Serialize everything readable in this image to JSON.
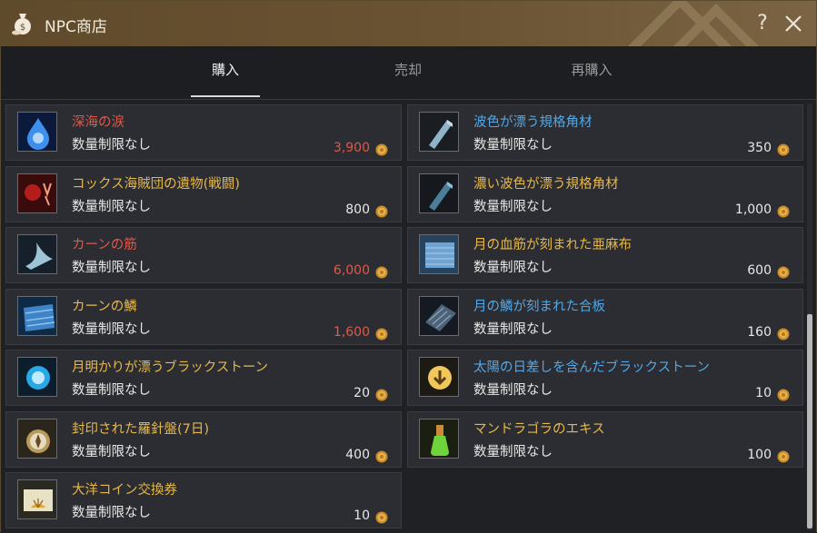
{
  "window": {
    "title": "NPC商店",
    "help_label": "?"
  },
  "tabs": [
    {
      "label": "購入",
      "active": true
    },
    {
      "label": "売却",
      "active": false
    },
    {
      "label": "再購入",
      "active": false
    }
  ],
  "colors": {
    "red_name": "#e0584a",
    "gold_name": "#e6b84a",
    "blue_name": "#52a7e4",
    "red_price": "#e0584a",
    "white_price": "#e8e8e8"
  },
  "items": [
    {
      "name": "深海の涙",
      "limit": "数量制限なし",
      "price": "3,900",
      "name_color": "red",
      "price_color": "red",
      "icon": "deep-sea-tear-icon"
    },
    {
      "name": "波色が漂う規格角材",
      "limit": "数量制限なし",
      "price": "350",
      "name_color": "blue",
      "price_color": "white",
      "icon": "wave-timber-icon"
    },
    {
      "name": "コックス海賊団の遺物(戦闘)",
      "limit": "数量制限なし",
      "price": "800",
      "name_color": "gold",
      "price_color": "white",
      "icon": "cox-pirate-relic-icon"
    },
    {
      "name": "濃い波色が漂う規格角材",
      "limit": "数量制限なし",
      "price": "1,000",
      "name_color": "gold",
      "price_color": "white",
      "icon": "deep-wave-timber-icon"
    },
    {
      "name": "カーンの筋",
      "limit": "数量制限なし",
      "price": "6,000",
      "name_color": "red",
      "price_color": "red",
      "icon": "khan-tendon-icon"
    },
    {
      "name": "月の血筋が刻まれた亜麻布",
      "limit": "数量制限なし",
      "price": "600",
      "name_color": "gold",
      "price_color": "white",
      "icon": "moon-linen-icon"
    },
    {
      "name": "カーンの鱗",
      "limit": "数量制限なし",
      "price": "1,600",
      "name_color": "gold",
      "price_color": "red",
      "icon": "khan-scale-icon"
    },
    {
      "name": "月の鱗が刻まれた合板",
      "limit": "数量制限なし",
      "price": "160",
      "name_color": "blue",
      "price_color": "white",
      "icon": "moon-plywood-icon"
    },
    {
      "name": "月明かりが漂うブラックストーン",
      "limit": "数量制限なし",
      "price": "20",
      "name_color": "gold",
      "price_color": "white",
      "icon": "moonlight-blackstone-icon"
    },
    {
      "name": "太陽の日差しを含んだブラックストーン",
      "limit": "数量制限なし",
      "price": "10",
      "name_color": "blue",
      "price_color": "white",
      "icon": "sunlight-blackstone-icon"
    },
    {
      "name": "封印された羅針盤(7日)",
      "limit": "数量制限なし",
      "price": "400",
      "name_color": "gold",
      "price_color": "white",
      "icon": "sealed-compass-icon"
    },
    {
      "name": "マンドラゴラのエキス",
      "limit": "数量制限なし",
      "price": "100",
      "name_color": "gold",
      "price_color": "white",
      "icon": "mandragora-essence-icon"
    },
    {
      "name": "大洋コイン交換券",
      "limit": "数量制限なし",
      "price": "10",
      "name_color": "gold",
      "price_color": "white",
      "icon": "ocean-coin-voucher-icon"
    }
  ]
}
